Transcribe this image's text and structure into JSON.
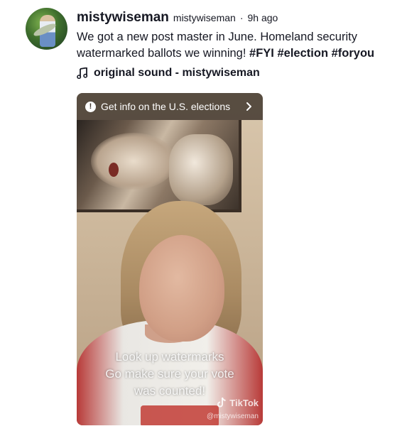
{
  "post": {
    "username": "mistywiseman",
    "nickname": "mistywiseman",
    "separator": "·",
    "time": "9h ago",
    "caption_text": "We got a new post master in June. Homeland security watermarked ballots we winning!",
    "hashtags": [
      "#FYI",
      "#election",
      "#foryou"
    ],
    "sound": "original sound - mistywiseman"
  },
  "video": {
    "banner_text": "Get info on the U.S. elections",
    "overlay_lines": [
      "Look up watermarks",
      "Go make sure your vote",
      "was counted!"
    ],
    "watermark_brand": "TikTok",
    "watermark_user": "@mistywiseman"
  },
  "icons": {
    "music": "music-note-icon",
    "info": "info-icon",
    "chevron": "chevron-right-icon",
    "tiktok": "tiktok-logo-icon"
  },
  "colors": {
    "text": "#161823",
    "banner_bg": "#3c322a"
  }
}
